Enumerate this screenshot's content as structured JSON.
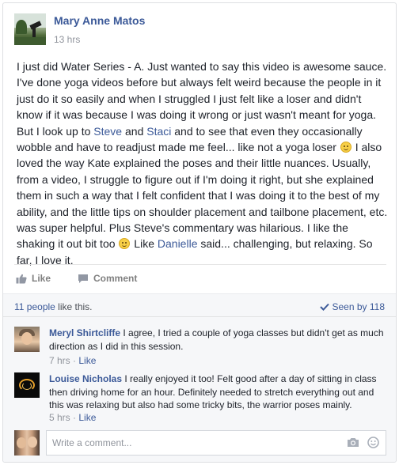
{
  "post": {
    "author": "Mary Anne Matos",
    "time": "13 hrs",
    "body": {
      "p1": "I just did Water Series - A. Just wanted to say this video is awesome sauce. I've done yoga videos before but always felt weird because the people in it just do it so easily and when I struggled I just felt like a loser and didn't know if it was because I was doing it wrong or just wasn't meant for yoga. But I look up to ",
      "link1": "Steve",
      "p2": " and ",
      "link2": "Staci",
      "p3": " and to see that even they occasionally wobble and have to readjust made me feel... like not a yoga loser ",
      "p4": " I also loved the way Kate explained the poses and their little nuances. Usually, from a video, I struggle to figure out if I'm doing it right, but she explained them in such a way that I felt confident that I was doing it to the best of my ability, and the little tips on shoulder placement and tailbone placement, etc. was super helpful. Plus Steve's commentary was hilarious. I like the shaking it out bit too ",
      "p5": " Like ",
      "link3": "Danielle",
      "p6": " said... challenging, but relaxing. So far, I love it."
    }
  },
  "actions": {
    "like_label": "Like",
    "comment_label": "Comment",
    "like_icon": "thumbs-up-icon",
    "comment_icon": "speech-bubble-icon"
  },
  "summary": {
    "likes_count": "11 people",
    "likes_suffix": " like this.",
    "seen_label": "Seen by 118",
    "seen_icon": "checkmark-icon"
  },
  "comments": [
    {
      "name": "Meryl Shirtcliffe",
      "text": " I agree, I tried a couple of yoga classes but didn't get as much direction as I did in this session.",
      "time": "7 hrs",
      "separator": " · ",
      "like": "Like"
    },
    {
      "name": "Louise Nicholas",
      "text": " I really enjoyed it too! Felt good after a day of sitting in class then driving home for an hour. Definitely needed to stretch everything out and this was relaxing but also had some tricky bits, the warrior poses mainly.",
      "time": "5 hrs",
      "separator": " · ",
      "like": "Like"
    }
  ],
  "composer": {
    "placeholder": "Write a comment...",
    "camera_icon": "camera-icon",
    "emoticon_icon": "emoticon-icon"
  },
  "colors": {
    "link": "#3b5998",
    "meta": "#90949c",
    "background_soft": "#f6f7f9"
  }
}
